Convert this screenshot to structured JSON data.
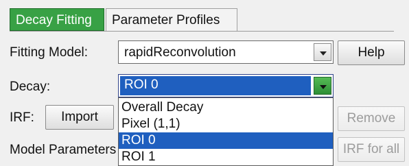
{
  "tabs": [
    {
      "label": "Decay Fitting",
      "active": true
    },
    {
      "label": "Parameter Profiles",
      "active": false
    }
  ],
  "fitting_model": {
    "label": "Fitting Model:",
    "value": "rapidReconvolution",
    "help_label": "Help"
  },
  "decay": {
    "label": "Decay:",
    "value": "ROI 0",
    "options": [
      "Overall Decay",
      "Pixel (1,1)",
      "ROI 0",
      "ROI 1"
    ],
    "selected_index": 2
  },
  "irf": {
    "label": "IRF:",
    "import_label": "Import",
    "remove_label": "Remove",
    "irf_for_all_label": "IRF for all"
  },
  "model_parameters": {
    "label": "Model Parameters"
  },
  "colors": {
    "tab_active": "#38a145",
    "selection": "#1f5fbf"
  }
}
